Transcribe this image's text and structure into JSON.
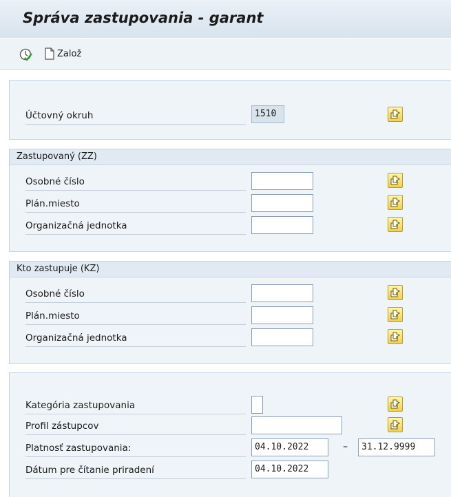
{
  "header": {
    "title": "Správa zastupovania - garant"
  },
  "toolbar": {
    "execute_icon": "execute-clock-icon",
    "create_label": "Založ"
  },
  "section_company": {
    "rows": [
      {
        "label": "Účtovný okruh",
        "value": "1510"
      }
    ]
  },
  "section_represented": {
    "title": "Zastupovaný (ZZ)",
    "rows": [
      {
        "label": "Osobné číslo",
        "value": ""
      },
      {
        "label": "Plán.miesto",
        "value": ""
      },
      {
        "label": "Organizačná jednotka",
        "value": ""
      }
    ]
  },
  "section_substitute": {
    "title": "Kto zastupuje (KZ)",
    "rows": [
      {
        "label": "Osobné číslo",
        "value": ""
      },
      {
        "label": "Plán.miesto",
        "value": ""
      },
      {
        "label": "Organizačná jednotka",
        "value": ""
      }
    ]
  },
  "section_details": {
    "rows": [
      {
        "label": "Kategória zastupovania",
        "value": ""
      },
      {
        "label": "Profil zástupcov",
        "value": ""
      },
      {
        "label": "Platnosť zastupovania:",
        "value_from": "04.10.2022",
        "separator": "–",
        "value_to": "31.12.9999"
      },
      {
        "label": "Dátum pre čítanie priradení",
        "value": "04.10.2022"
      }
    ]
  },
  "colors": {
    "panel_bg": "#eff4f9",
    "multisel_button": "#f0d14a"
  }
}
